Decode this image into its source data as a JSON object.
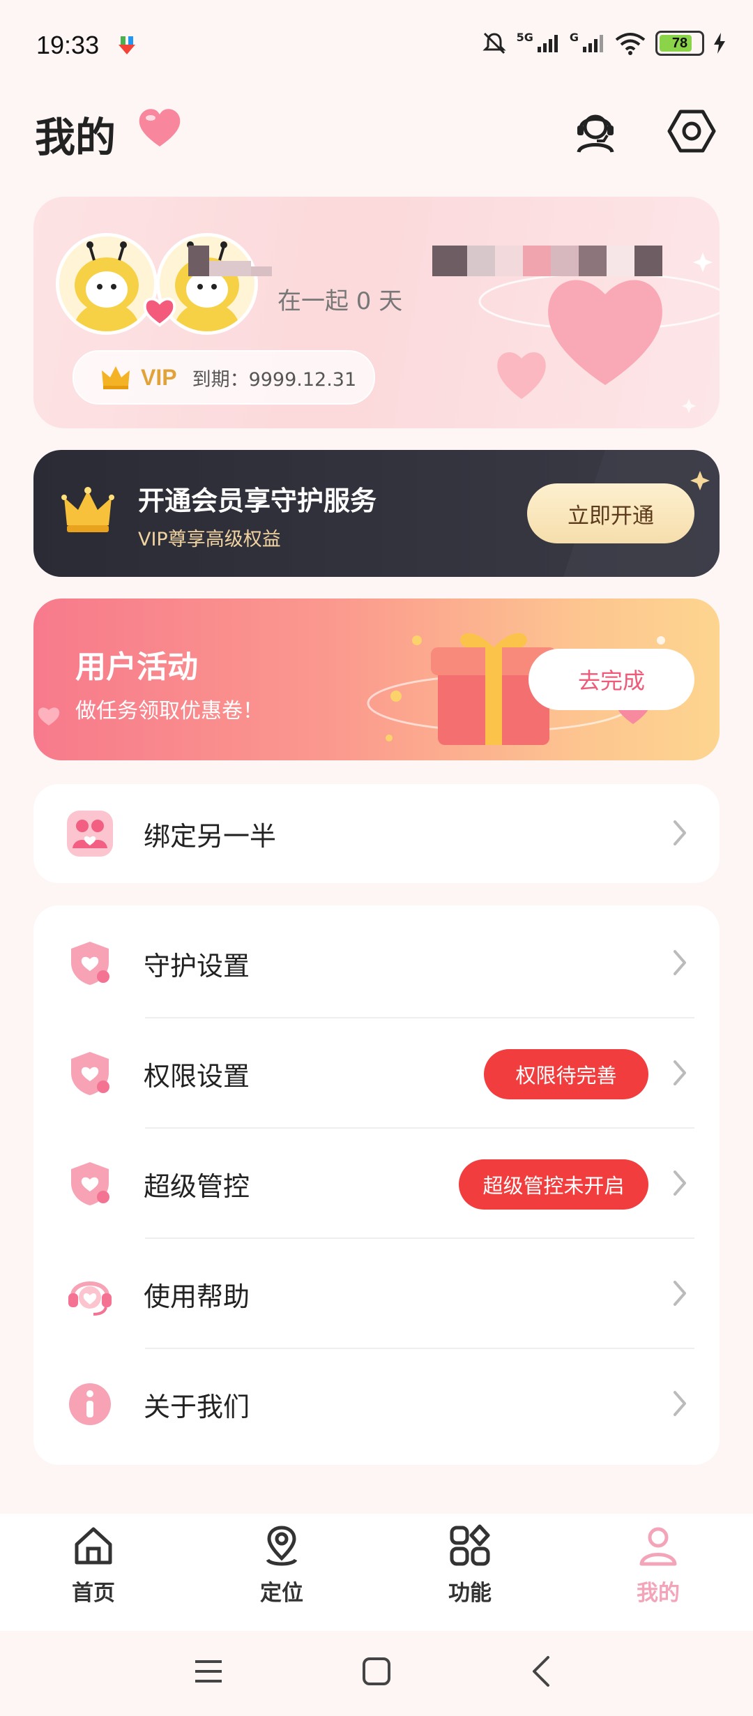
{
  "status_bar": {
    "time": "19:33",
    "network_1": "5G",
    "network_2": "G",
    "battery": "78"
  },
  "header": {
    "title": "我的",
    "support_icon": "customer-service-icon",
    "settings_icon": "settings-hexagon-icon"
  },
  "profile": {
    "together_days": "在一起 0 天",
    "vip_label": "VIP",
    "vip_expire": "到期：9999.12.31"
  },
  "member_banner": {
    "title": "开通会员享守护服务",
    "subtitle": "VIP尊享高级权益",
    "button": "立即开通"
  },
  "activity_banner": {
    "title": "用户活动",
    "subtitle": "做任务领取优惠卷！",
    "button": "去完成"
  },
  "bind_card": {
    "label": "绑定另一半"
  },
  "settings_list": {
    "items": [
      {
        "label": "守护设置",
        "icon": "shield-heart-icon"
      },
      {
        "label": "权限设置",
        "icon": "shield-heart-icon",
        "badge": "权限待完善"
      },
      {
        "label": "超级管控",
        "icon": "shield-heart-icon",
        "badge": "超级管控未开启"
      },
      {
        "label": "使用帮助",
        "icon": "headset-heart-icon"
      },
      {
        "label": "关于我们",
        "icon": "info-icon"
      }
    ]
  },
  "bottom_nav": {
    "items": [
      {
        "label": "首页",
        "icon": "home-icon"
      },
      {
        "label": "定位",
        "icon": "location-icon"
      },
      {
        "label": "功能",
        "icon": "apps-icon"
      },
      {
        "label": "我的",
        "icon": "user-icon"
      }
    ],
    "active_index": 3
  },
  "colors": {
    "accent_pink": "#f4a4b9",
    "badge_red": "#f13d3d",
    "vip_gold": "#e0a33a"
  }
}
